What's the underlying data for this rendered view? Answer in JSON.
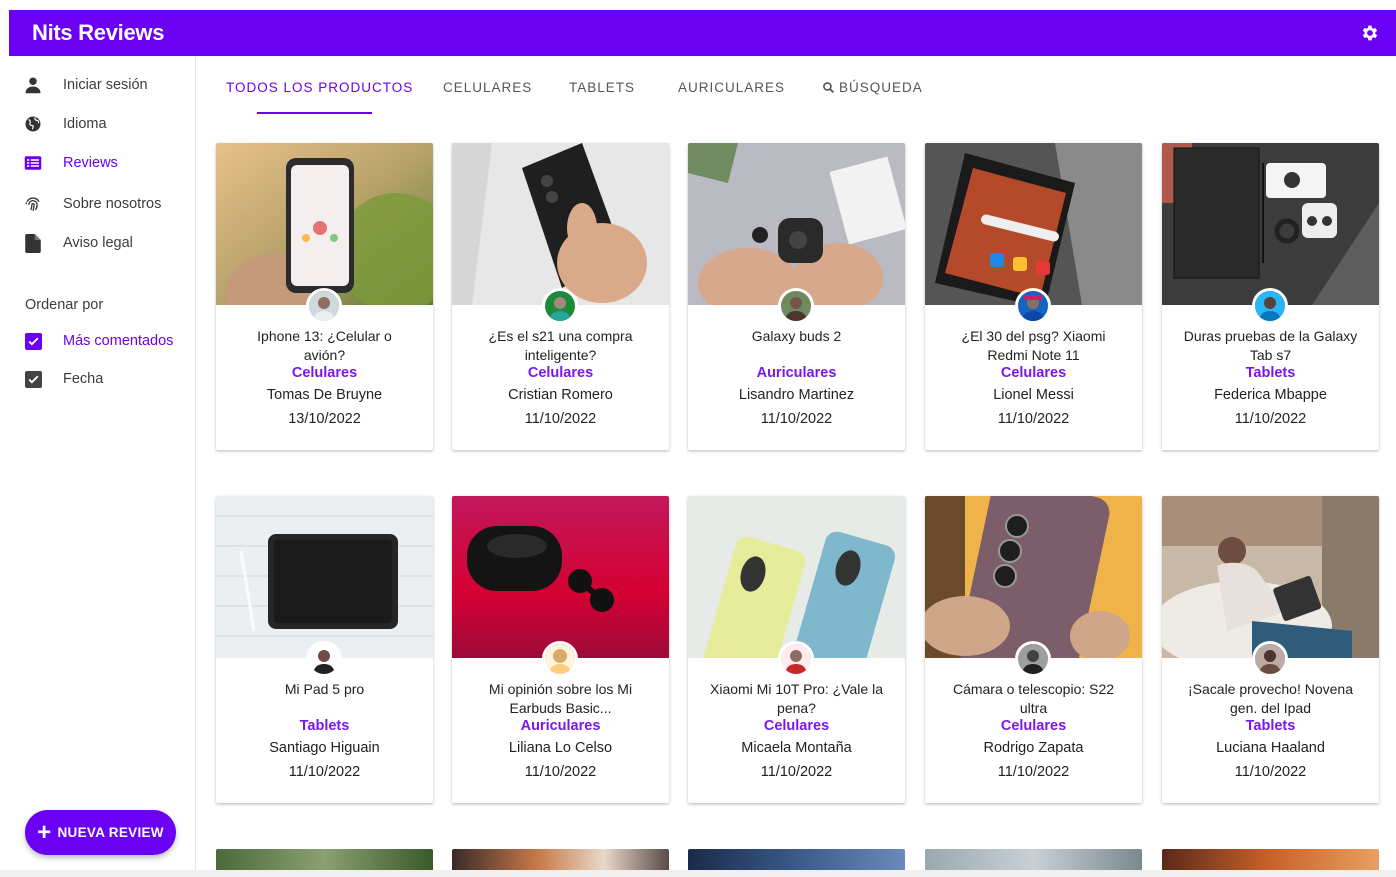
{
  "app": {
    "title": "Nits Reviews"
  },
  "sidebar": {
    "items": [
      {
        "label": "Iniciar sesión",
        "icon": "user-icon"
      },
      {
        "label": "Idioma",
        "icon": "globe-icon"
      },
      {
        "label": "Reviews",
        "icon": "list-icon"
      },
      {
        "label": "Sobre nosotros",
        "icon": "fingerprint-icon"
      },
      {
        "label": "Aviso legal",
        "icon": "document-icon"
      }
    ],
    "sort_label": "Ordenar por",
    "sort_options": [
      {
        "label": "Más comentados",
        "checked": true
      },
      {
        "label": "Fecha",
        "checked": true
      }
    ],
    "new_review_label": "NUEVA REVIEW"
  },
  "tabs": [
    {
      "label": "TODOS LOS PRODUCTOS"
    },
    {
      "label": "CELULARES"
    },
    {
      "label": "TABLETS"
    },
    {
      "label": "AURICULARES"
    },
    {
      "label": "BÚSQUEDA"
    }
  ],
  "cards": [
    {
      "title": "Iphone 13: ¿Celular o avión?",
      "category": "Celulares",
      "author": "Tomas De Bruyne",
      "date": "13/10/2022"
    },
    {
      "title": "¿Es el s21 una compra inteligente?",
      "category": "Celulares",
      "author": "Cristian Romero",
      "date": "11/10/2022"
    },
    {
      "title": "Galaxy buds 2",
      "category": "Auriculares",
      "author": "Lisandro Martinez",
      "date": "11/10/2022"
    },
    {
      "title": "¿El 30 del psg? Xiaomi Redmi Note 11",
      "category": "Celulares",
      "author": "Lionel Messi",
      "date": "11/10/2022"
    },
    {
      "title": "Duras pruebas de la Galaxy Tab s7",
      "category": "Tablets",
      "author": "Federica Mbappe",
      "date": "11/10/2022"
    },
    {
      "title": "Mi Pad 5 pro",
      "category": "Tablets",
      "author": "Santiago Higuain",
      "date": "11/10/2022"
    },
    {
      "title": "Mi opinión sobre los Mi Earbuds Basic...",
      "category": "Auriculares",
      "author": "Liliana Lo Celso",
      "date": "11/10/2022"
    },
    {
      "title": "Xiaomi Mi 10T Pro: ¿Vale la pena?",
      "category": "Celulares",
      "author": "Micaela Montaña",
      "date": "11/10/2022"
    },
    {
      "title": "Cámara o telescopio: S22 ultra",
      "category": "Celulares",
      "author": "Rodrigo Zapata",
      "date": "11/10/2022"
    },
    {
      "title": "¡Sacale provecho! Novena gen. del Ipad",
      "category": "Tablets",
      "author": "Luciana Haaland",
      "date": "11/10/2022"
    }
  ],
  "colors": {
    "accent": "#6a00f4",
    "category": "#7b16f2"
  }
}
